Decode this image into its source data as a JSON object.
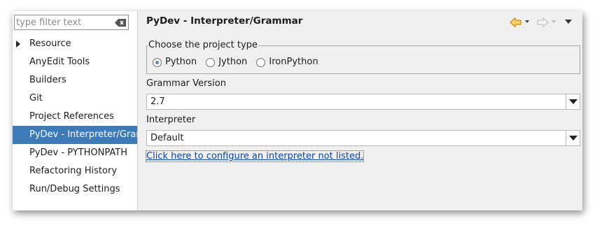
{
  "sidebar": {
    "filter_placeholder": "type filter text",
    "items": [
      {
        "label": "Resource",
        "expandable": true
      },
      {
        "label": "AnyEdit Tools"
      },
      {
        "label": "Builders"
      },
      {
        "label": "Git"
      },
      {
        "label": "Project References"
      },
      {
        "label": "PyDev - Interpreter/Grammar",
        "selected": true
      },
      {
        "label": "PyDev - PYTHONPATH"
      },
      {
        "label": "Refactoring History"
      },
      {
        "label": "Run/Debug Settings"
      }
    ]
  },
  "main": {
    "title": "PyDev - Interpreter/Grammar",
    "project_type": {
      "legend": "Choose the project type",
      "options": [
        "Python",
        "Jython",
        "IronPython"
      ],
      "selected": "Python"
    },
    "grammar": {
      "label": "Grammar Version",
      "value": "2.7"
    },
    "interpreter": {
      "label": "Interpreter",
      "value": "Default"
    },
    "configure_link": "Click here to configure an interpreter not listed."
  },
  "colors": {
    "selection": "#3c7ab8",
    "link": "#0645ad",
    "back_arrow": "#e8a000"
  },
  "icons": [
    "clear-filter-icon",
    "back-arrow-icon",
    "forward-arrow-icon",
    "view-menu-icon"
  ]
}
